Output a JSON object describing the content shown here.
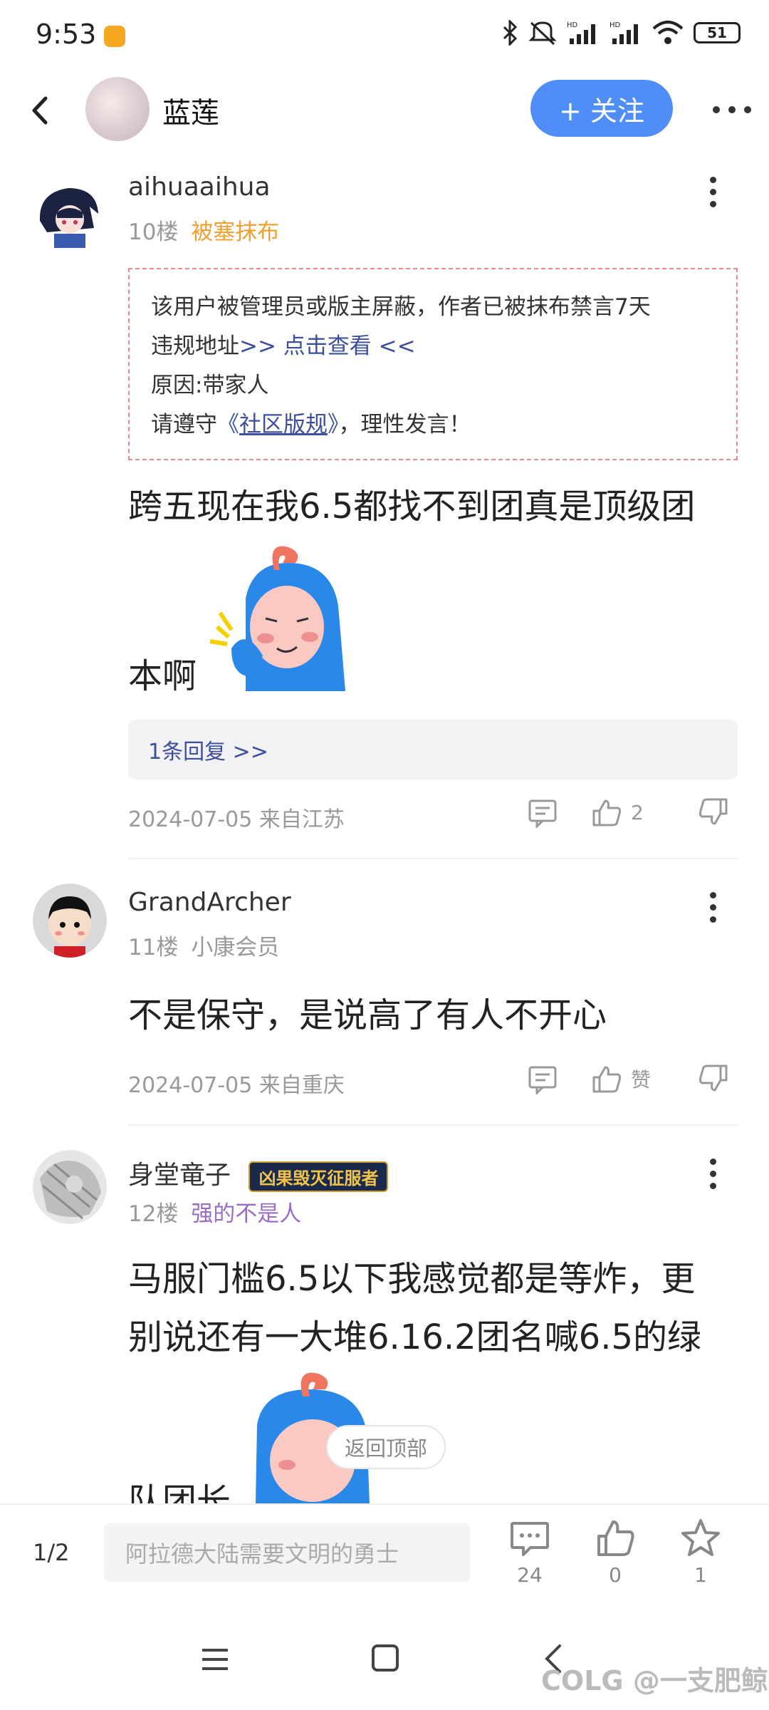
{
  "status": {
    "time": "9:53",
    "icons": [
      "bluetooth-icon",
      "mute-icon",
      "signal-hd-icon",
      "signal-hd-icon",
      "wifi-icon"
    ],
    "battery": "51"
  },
  "header": {
    "title": "蓝莲",
    "follow_label": "+ 关注"
  },
  "posts": [
    {
      "username": "aihuaaihua",
      "floor": "10楼",
      "tag": "被塞抹布",
      "tag_color": "#f0a030",
      "notice": {
        "line1": "该用户被管理员或版主屏蔽，作者已被抹布禁言7天",
        "line2_prefix": "违规地址",
        "line2_link": ">> 点击查看 <<",
        "line3": "原因:带家人",
        "line4_prefix": "请遵守",
        "line4_open": "《",
        "line4_link": "社区版规",
        "line4_close": "》",
        "line4_suffix": "，理性发言！"
      },
      "text_line1": "跨五现在我6.5都找不到团真是顶级团",
      "text_line2": "本啊",
      "replies": "1条回复 >>",
      "date": "2024-07-05 来自江苏",
      "likes": "2"
    },
    {
      "username": "GrandArcher",
      "floor": "11楼",
      "tag": "小康会员",
      "tag_color": "#999999",
      "text": "不是保守，是说高了有人不开心",
      "date": "2024-07-05 来自重庆",
      "likes": "赞"
    },
    {
      "username": "身堂竜子",
      "badge": "凶果毁灭征服者",
      "floor": "12楼",
      "tag": "强的不是人",
      "tag_color": "#9a6cc7",
      "text_line1": "马服门槛6.5以下我感觉都是等炸，更",
      "text_line2": "别说还有一大堆6.16.2团名喊6.5的绿",
      "text_line3": "队团长"
    }
  ],
  "back_to_top": "返回顶部",
  "bottom_bar": {
    "page": "1/2",
    "placeholder": "阿拉德大陆需要文明的勇士",
    "comments": "24",
    "likes": "0",
    "favorites": "1"
  },
  "watermark": "COLG @一支肥鲸",
  "colors": {
    "accent": "#4f8ef7",
    "link": "#3d4f9c",
    "notice_border": "#e88a8a"
  }
}
